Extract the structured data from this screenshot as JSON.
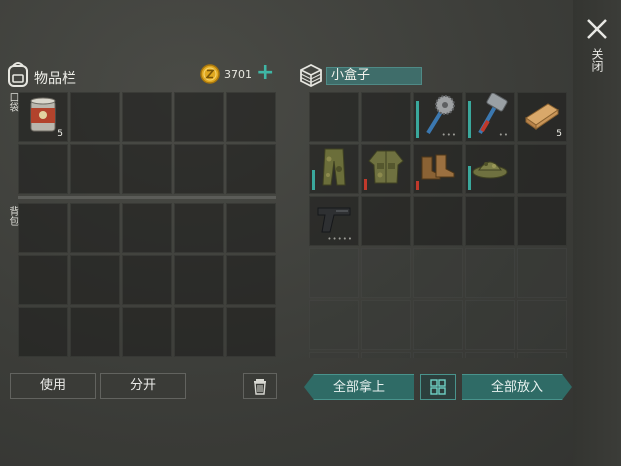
{
  "close": {
    "label": "关闭",
    "icon": "close-icon"
  },
  "inventory": {
    "title": "物品栏",
    "coins": "3701",
    "add_label": "+",
    "pocket_label": "口袋",
    "backpack_label": "背包",
    "pocket_slots": [
      {
        "item": "canned-food-icon",
        "qty": "5"
      },
      {},
      {},
      {},
      {},
      {},
      {},
      {},
      {},
      {}
    ],
    "backpack_slots": [
      {},
      {},
      {},
      {},
      {},
      {},
      {},
      {},
      {},
      {},
      {},
      {},
      {},
      {},
      {}
    ]
  },
  "box": {
    "title": "小盒子",
    "slots": [
      {},
      {},
      {
        "item": "saw-blade-mace-icon",
        "dots": "•••",
        "bar_color": "#3aa89c",
        "bar_level": 0.85
      },
      {
        "item": "sledgehammer-icon",
        "dots": "••",
        "bar_color": "#3aa89c",
        "bar_level": 0.85
      },
      {
        "item": "wood-plank-icon",
        "qty": "5"
      },
      {
        "item": "camo-pants-icon",
        "bar_color": "#3aa89c",
        "bar_level": 0.45
      },
      {
        "item": "camo-jacket-icon",
        "bar_color": "#c0392b",
        "bar_level": 0.25
      },
      {
        "item": "boots-icon",
        "bar_color": "#c0392b",
        "bar_level": 0.2
      },
      {
        "item": "camo-hat-icon",
        "bar_color": "#3aa89c",
        "bar_level": 0.55
      },
      {},
      {
        "item": "pistol-icon",
        "dots": "•••••"
      },
      {},
      {},
      {},
      {},
      {},
      {},
      {},
      {},
      {},
      {},
      {},
      {},
      {},
      {},
      {},
      {},
      {},
      {},
      {}
    ]
  },
  "buttons": {
    "use": "使用",
    "split": "分开",
    "take_all": "全部拿上",
    "put_all": "全部放入"
  },
  "colors": {
    "accent_teal": "#2f6b66",
    "coin_gold": "#e0a820",
    "durability_green": "#3aa89c",
    "durability_red": "#c0392b"
  }
}
